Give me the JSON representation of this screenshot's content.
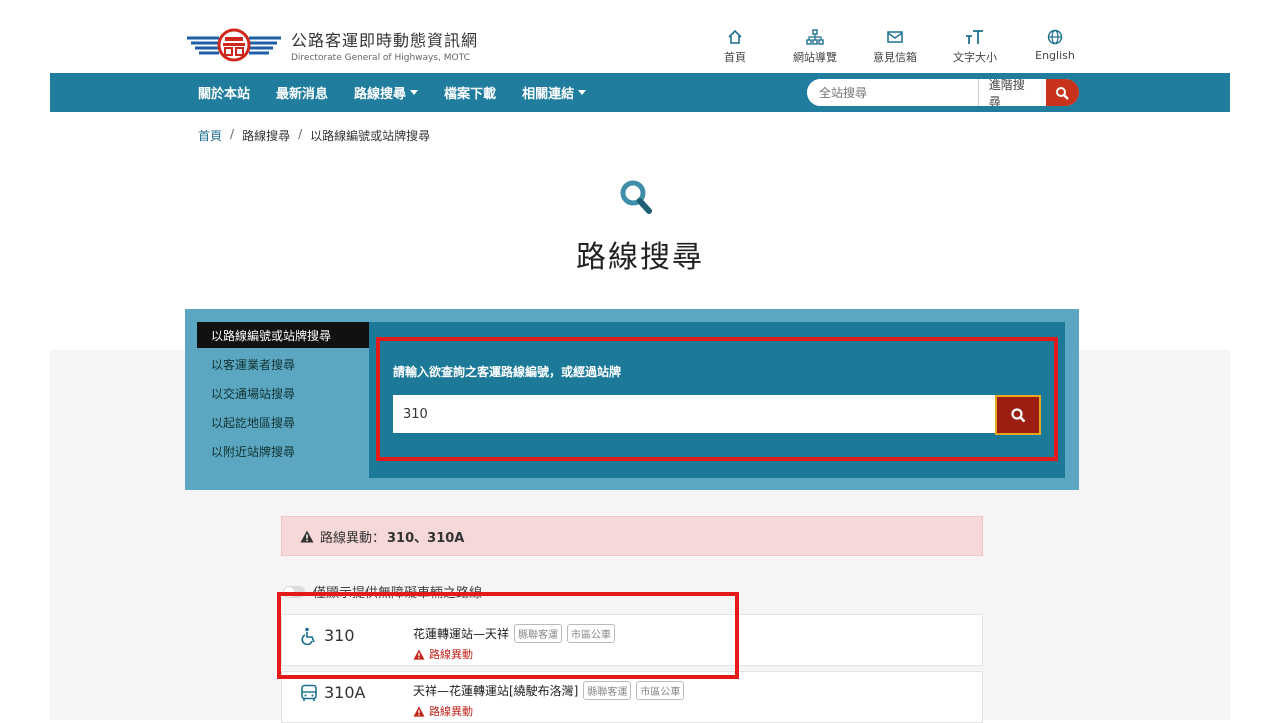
{
  "header": {
    "logo_title": "公路客運即時動態資訊網",
    "logo_subtitle": "Directorate General of Highways, MOTC",
    "top_links": [
      {
        "label": "首頁",
        "icon": "home-icon"
      },
      {
        "label": "網站導覽",
        "icon": "sitemap-icon"
      },
      {
        "label": "意見信箱",
        "icon": "mail-icon"
      },
      {
        "label": "文字大小",
        "icon": "text-size-icon"
      },
      {
        "label": "English",
        "icon": "globe-icon"
      }
    ]
  },
  "nav": {
    "items": [
      "關於本站",
      "最新消息",
      "路線搜尋",
      "檔案下載",
      "相關連結"
    ],
    "search_placeholder": "全站搜尋",
    "advanced_search": "進階搜尋"
  },
  "breadcrumb": [
    "首頁",
    "路線搜尋",
    "以路線編號或站牌搜尋"
  ],
  "page_title": "路線搜尋",
  "search_panel": {
    "tabs": [
      "以路線編號或站牌搜尋",
      "以客運業者搜尋",
      "以交通場站搜尋",
      "以起訖地區搜尋",
      "以附近站牌搜尋"
    ],
    "active_tab": 0,
    "label": "請輸入欲查詢之客運路線編號，或經過站牌",
    "input_value": "310"
  },
  "alert": {
    "prefix": "路線異動：",
    "routes": "310、310A"
  },
  "toggle_label": "僅顯示提供無障礙車輛之路線",
  "results": [
    {
      "number": "310",
      "name": "花蓮轉運站—天祥",
      "tags": [
        "縣聯客運",
        "市區公車"
      ],
      "status": "路線異動",
      "icon": "wheelchair-icon"
    },
    {
      "number": "310A",
      "name": "天祥—花蓮轉運站[繞駛布洛灣]",
      "tags": [
        "縣聯客運",
        "市區公車"
      ],
      "status": "路線異動",
      "icon": "bus-icon"
    }
  ],
  "colors": {
    "nav_bg": "#207d9d",
    "panel_outer": "#5ba7c1",
    "panel_inner": "#1c7a98",
    "accent_red": "#c7321c",
    "alert_bg": "#f6d8d9",
    "highlight_box": "#e41a1a"
  }
}
